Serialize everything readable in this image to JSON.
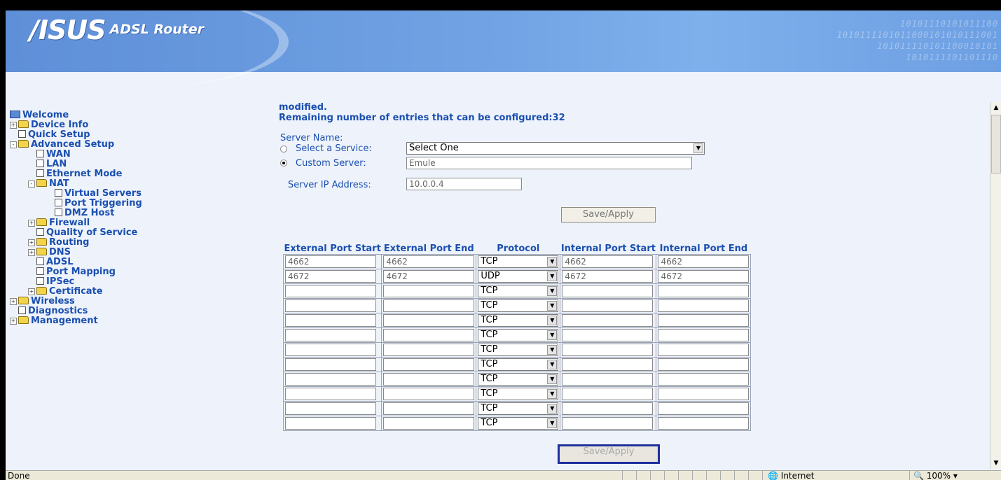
{
  "banner": {
    "logo": "/ISUS",
    "product": "ADSL Router"
  },
  "nav": {
    "welcome": "Welcome",
    "items": [
      {
        "label": "Device Info",
        "level": 0,
        "type": "folder",
        "expand": "+"
      },
      {
        "label": "Quick Setup",
        "level": 0,
        "type": "page"
      },
      {
        "label": "Advanced Setup",
        "level": 0,
        "type": "folder-open",
        "expand": "-"
      },
      {
        "label": "WAN",
        "level": 1,
        "type": "page"
      },
      {
        "label": "LAN",
        "level": 1,
        "type": "page"
      },
      {
        "label": "Ethernet Mode",
        "level": 1,
        "type": "page"
      },
      {
        "label": "NAT",
        "level": 1,
        "type": "folder-open",
        "expand": "-"
      },
      {
        "label": "Virtual Servers",
        "level": 2,
        "type": "page"
      },
      {
        "label": "Port Triggering",
        "level": 2,
        "type": "page"
      },
      {
        "label": "DMZ Host",
        "level": 2,
        "type": "page"
      },
      {
        "label": "Firewall",
        "level": 1,
        "type": "folder",
        "expand": "+"
      },
      {
        "label": "Quality of Service",
        "level": 1,
        "type": "page"
      },
      {
        "label": "Routing",
        "level": 1,
        "type": "folder",
        "expand": "+"
      },
      {
        "label": "DNS",
        "level": 1,
        "type": "folder",
        "expand": "+"
      },
      {
        "label": "ADSL",
        "level": 1,
        "type": "page"
      },
      {
        "label": "Port Mapping",
        "level": 1,
        "type": "page"
      },
      {
        "label": "IPSec",
        "level": 1,
        "type": "page"
      },
      {
        "label": "Certificate",
        "level": 1,
        "type": "folder",
        "expand": "+"
      },
      {
        "label": "Wireless",
        "level": 0,
        "type": "folder",
        "expand": "+"
      },
      {
        "label": "Diagnostics",
        "level": 0,
        "type": "page"
      },
      {
        "label": "Management",
        "level": 0,
        "type": "folder",
        "expand": "+"
      }
    ]
  },
  "main": {
    "msg_line1": "modified.",
    "msg_line2": "Remaining number of entries that can be configured:32",
    "server_name_label": "Server Name:",
    "select_service_label": "Select a Service:",
    "select_service_value": "Select One",
    "custom_server_label": "Custom Server:",
    "custom_server_value": "Emule",
    "server_ip_label": "Server IP Address:",
    "server_ip_value": "10.0.0.4",
    "save_label": "Save/Apply",
    "save_label_bottom": "Save/Apply"
  },
  "table": {
    "headers": [
      "External Port Start",
      "External Port End",
      "Protocol",
      "Internal Port Start",
      "Internal Port End"
    ],
    "rows": [
      [
        "4662",
        "4662",
        "TCP",
        "4662",
        "4662"
      ],
      [
        "4672",
        "4672",
        "UDP",
        "4672",
        "4672"
      ],
      [
        "",
        "",
        "TCP",
        "",
        ""
      ],
      [
        "",
        "",
        "TCP",
        "",
        ""
      ],
      [
        "",
        "",
        "TCP",
        "",
        ""
      ],
      [
        "",
        "",
        "TCP",
        "",
        ""
      ],
      [
        "",
        "",
        "TCP",
        "",
        ""
      ],
      [
        "",
        "",
        "TCP",
        "",
        ""
      ],
      [
        "",
        "",
        "TCP",
        "",
        ""
      ],
      [
        "",
        "",
        "TCP",
        "",
        ""
      ],
      [
        "",
        "",
        "TCP",
        "",
        ""
      ],
      [
        "",
        "",
        "TCP",
        "",
        ""
      ]
    ]
  },
  "statusbar": {
    "left": "Done",
    "zone": "Internet",
    "zoom": "100%"
  }
}
